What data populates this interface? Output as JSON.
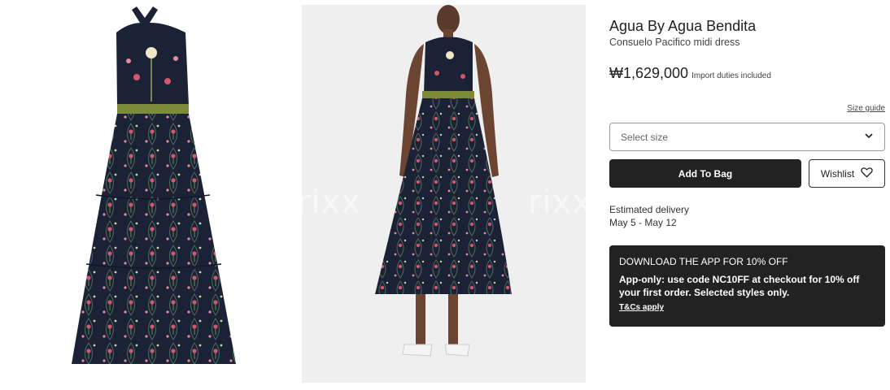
{
  "gallery": {
    "watermark": "rixx",
    "images": [
      {
        "icon": "dress-flat-image"
      },
      {
        "icon": "dress-model-image"
      }
    ]
  },
  "product": {
    "brand": "Agua By Agua Bendita",
    "name": "Consuelo Pacifico midi dress",
    "price": "₩1,629,000",
    "duties_note": "Import duties included"
  },
  "size": {
    "guide_label": "Size guide",
    "placeholder": "Select size"
  },
  "actions": {
    "add_to_bag": "Add To Bag",
    "wishlist": "Wishlist"
  },
  "delivery": {
    "label": "Estimated delivery",
    "range": "May 5 - May 12"
  },
  "promo": {
    "title": "DOWNLOAD THE APP FOR 10% OFF",
    "body": "App-only: use code NC10FF at checkout for 10% off your first order. Selected styles only.",
    "link": "T&Cs apply"
  },
  "colors": {
    "dark": "#222222",
    "dress_navy": "#1c2236",
    "belt_olive": "#7d8a3a",
    "background_grey": "#efefef"
  }
}
